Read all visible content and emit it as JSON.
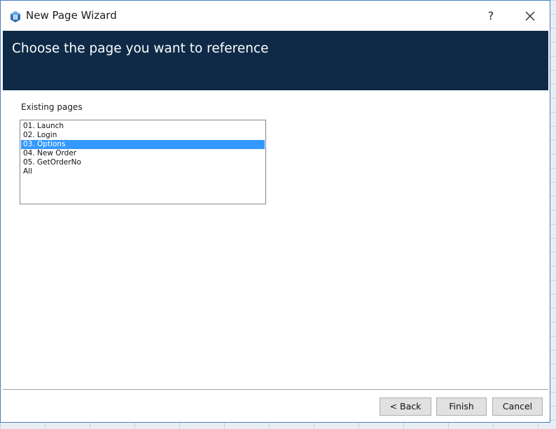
{
  "window": {
    "title": "New Page Wizard",
    "help_label": "?",
    "close_label": "✕",
    "app_icon": "wizard-app-icon"
  },
  "banner": {
    "title": "Choose the page you want to reference",
    "background": "#0e2a47"
  },
  "pages": {
    "label": "Existing pages",
    "items": [
      {
        "label": "01. Launch",
        "selected": false
      },
      {
        "label": "02. Login",
        "selected": false
      },
      {
        "label": "03. Options",
        "selected": true
      },
      {
        "label": "04. New Order",
        "selected": false
      },
      {
        "label": "05. GetOrderNo",
        "selected": false
      },
      {
        "label": "All",
        "selected": false
      }
    ],
    "selection_color": "#3399ff"
  },
  "footer": {
    "back_label": "< Back",
    "finish_label": "Finish",
    "cancel_label": "Cancel"
  }
}
